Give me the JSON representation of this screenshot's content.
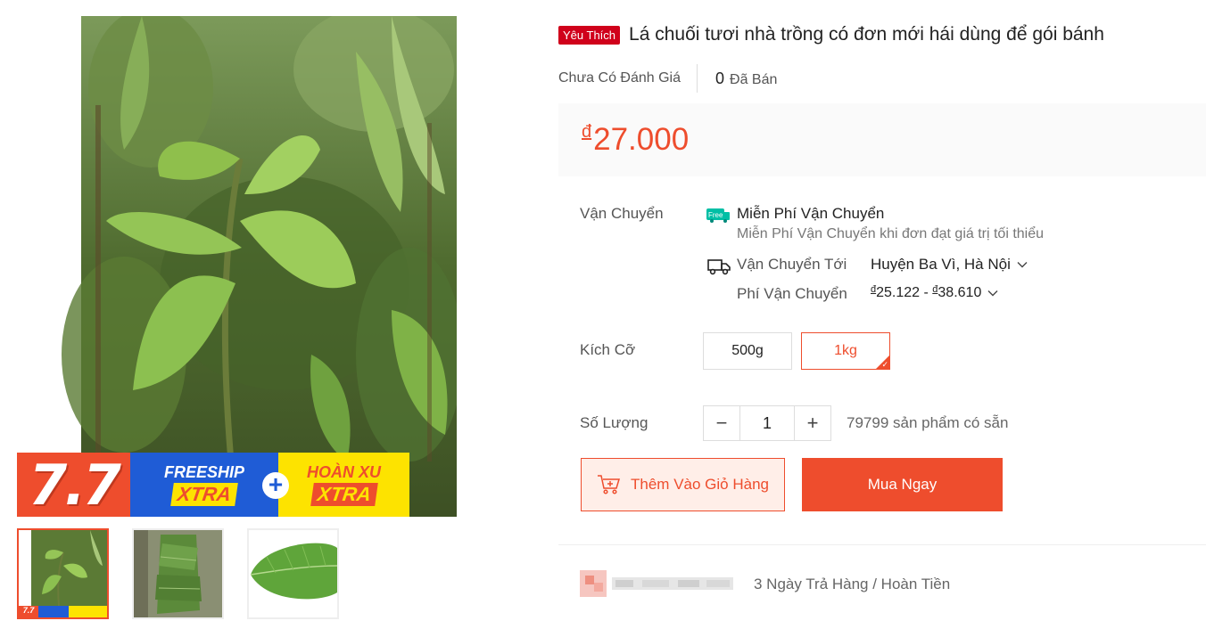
{
  "gallery": {
    "promo": {
      "sale_label": "7.7",
      "freeship_title": "FREESHIP",
      "freeship_tag": "XTRA",
      "plus": "+",
      "coin_title": "HOÀN XU",
      "coin_tag": "XTRA"
    },
    "thumbnails": [
      {
        "name": "banana-trees",
        "active": true
      },
      {
        "name": "leaf-bundle",
        "active": false
      },
      {
        "name": "single-leaf",
        "active": false
      }
    ],
    "mini_banner": "7.7"
  },
  "product": {
    "badge": "Yêu Thích",
    "title": "Lá chuối tươi nhà trồng có đơn mới hái dùng để gói bánh",
    "rating_text": "Chưa Có Đánh Giá",
    "sold_count": "0",
    "sold_label": "Đã Bán",
    "price_currency": "đ",
    "price": "27.000"
  },
  "shipping": {
    "label": "Vận Chuyển",
    "free_icon_text": "Free",
    "free_title": "Miễn Phí Vận Chuyển",
    "free_desc": "Miễn Phí Vận Chuyển khi đơn đạt giá trị tối thiểu",
    "ship_to_label": "Vận Chuyển Tới",
    "ship_to_value": "Huyện Ba Vì, Hà Nội",
    "fee_label": "Phí Vận Chuyển",
    "fee_currency": "đ",
    "fee_min": "25.122",
    "fee_sep": " - ",
    "fee_max": "38.610"
  },
  "variants": {
    "label": "Kích Cỡ",
    "options": [
      "500g",
      "1kg"
    ],
    "selected": "1kg"
  },
  "quantity": {
    "label": "Số Lượng",
    "minus": "−",
    "value": "1",
    "plus": "+",
    "stock": "79799 sản phẩm có sẵn"
  },
  "actions": {
    "add_to_cart": "Thêm Vào Giỏ Hàng",
    "buy_now": "Mua Ngay"
  },
  "guarantee": {
    "text": "3 Ngày Trả Hàng / Hoàn Tiền"
  },
  "colors": {
    "brand": "#ee4d2d",
    "badge": "#d0011b",
    "freeship_blue": "#1f5cd6",
    "promo_yellow": "#fde300",
    "free_icon": "#00bfa5"
  }
}
